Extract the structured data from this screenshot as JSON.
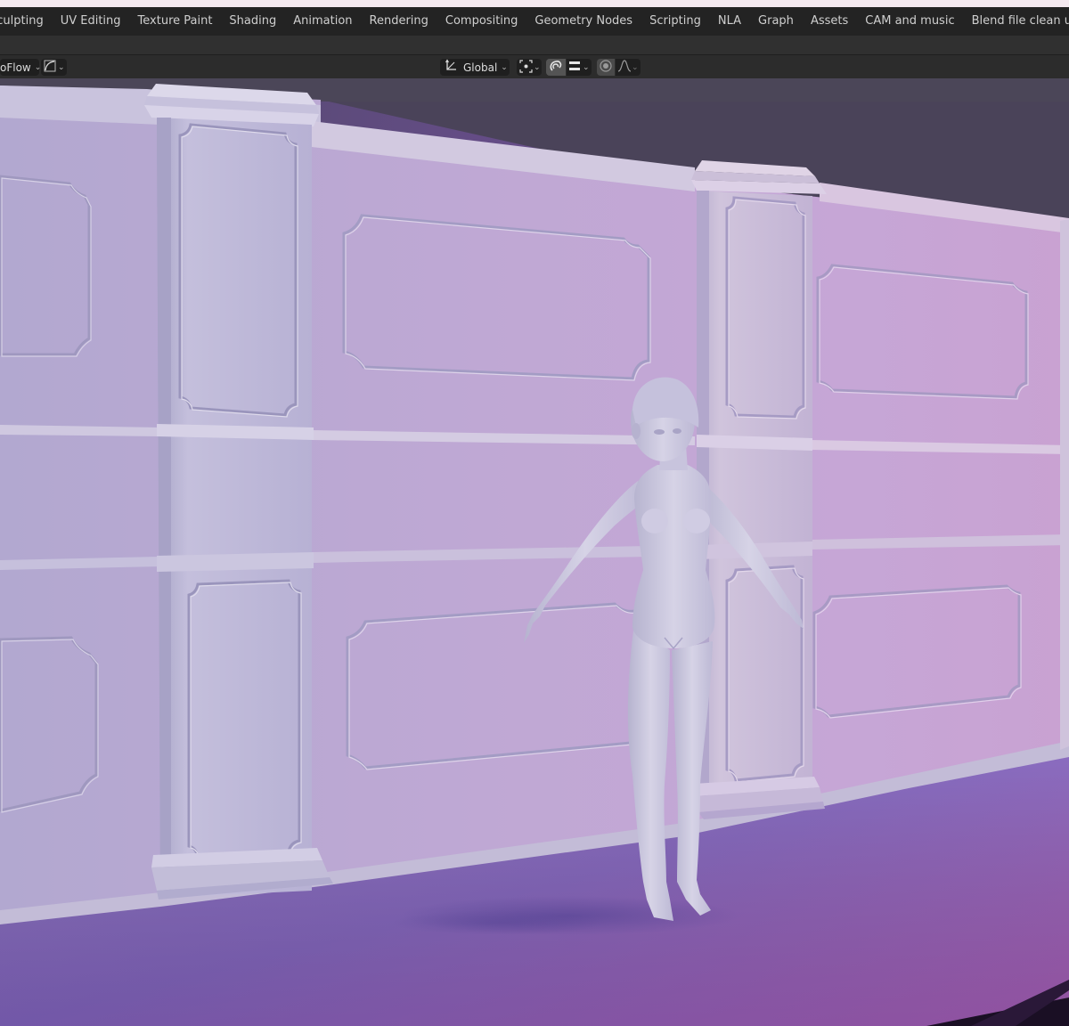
{
  "workspaces": {
    "tabs": [
      "Sculpting",
      "UV Editing",
      "Texture Paint",
      "Shading",
      "Animation",
      "Rendering",
      "Compositing",
      "Geometry Nodes",
      "Scripting",
      "NLA",
      "Graph",
      "Assets",
      "CAM and music",
      "Blend file clean up"
    ],
    "add_label": "+"
  },
  "toolbar": {
    "brush_name": "oFlow",
    "orientation": "Global"
  },
  "icons": {
    "orientation": "transform-axes-icon",
    "pivot": "pivot-point-icon",
    "snap": "snap-magnet-icon",
    "snap_increment": "snap-increment-icon",
    "proportional": "proportional-edit-icon",
    "falloff": "falloff-curve-icon"
  },
  "colors": {
    "workspace_bg": "#232323",
    "toolbar_bg": "#2c2c2c",
    "wall": "#b9a9cf",
    "floor": "#8a6db8",
    "accent_pink": "#a552b8"
  }
}
